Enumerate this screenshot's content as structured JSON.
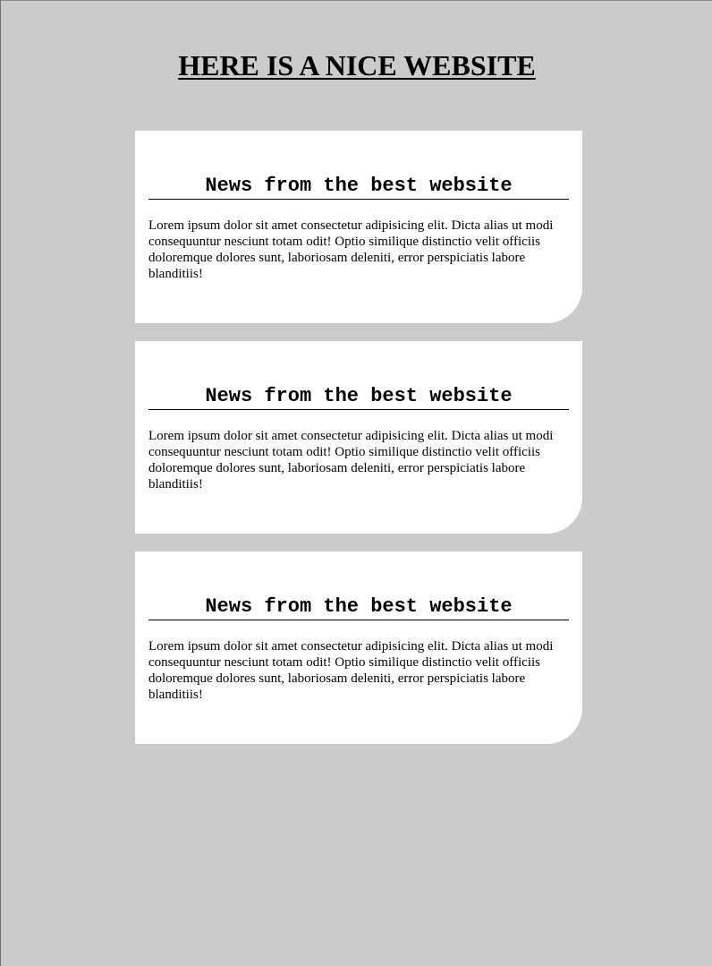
{
  "page": {
    "title": "HERE IS A NICE WEBSITE"
  },
  "cards": [
    {
      "heading": "News from the best website",
      "body": "Lorem ipsum dolor sit amet consectetur adipisicing elit. Dicta alias ut modi consequuntur nesciunt totam odit! Optio similique distinctio velit officiis doloremque dolores sunt, laboriosam deleniti, error perspiciatis labore blanditiis!"
    },
    {
      "heading": "News from the best website",
      "body": "Lorem ipsum dolor sit amet consectetur adipisicing elit. Dicta alias ut modi consequuntur nesciunt totam odit! Optio similique distinctio velit officiis doloremque dolores sunt, laboriosam deleniti, error perspiciatis labore blanditiis!"
    },
    {
      "heading": "News from the best website",
      "body": "Lorem ipsum dolor sit amet consectetur adipisicing elit. Dicta alias ut modi consequuntur nesciunt totam odit! Optio similique distinctio velit officiis doloremque dolores sunt, laboriosam deleniti, error perspiciatis labore blanditiis!"
    }
  ],
  "colors": {
    "background": "#cbcbcb",
    "card": "#ffffff",
    "text": "#000000"
  }
}
